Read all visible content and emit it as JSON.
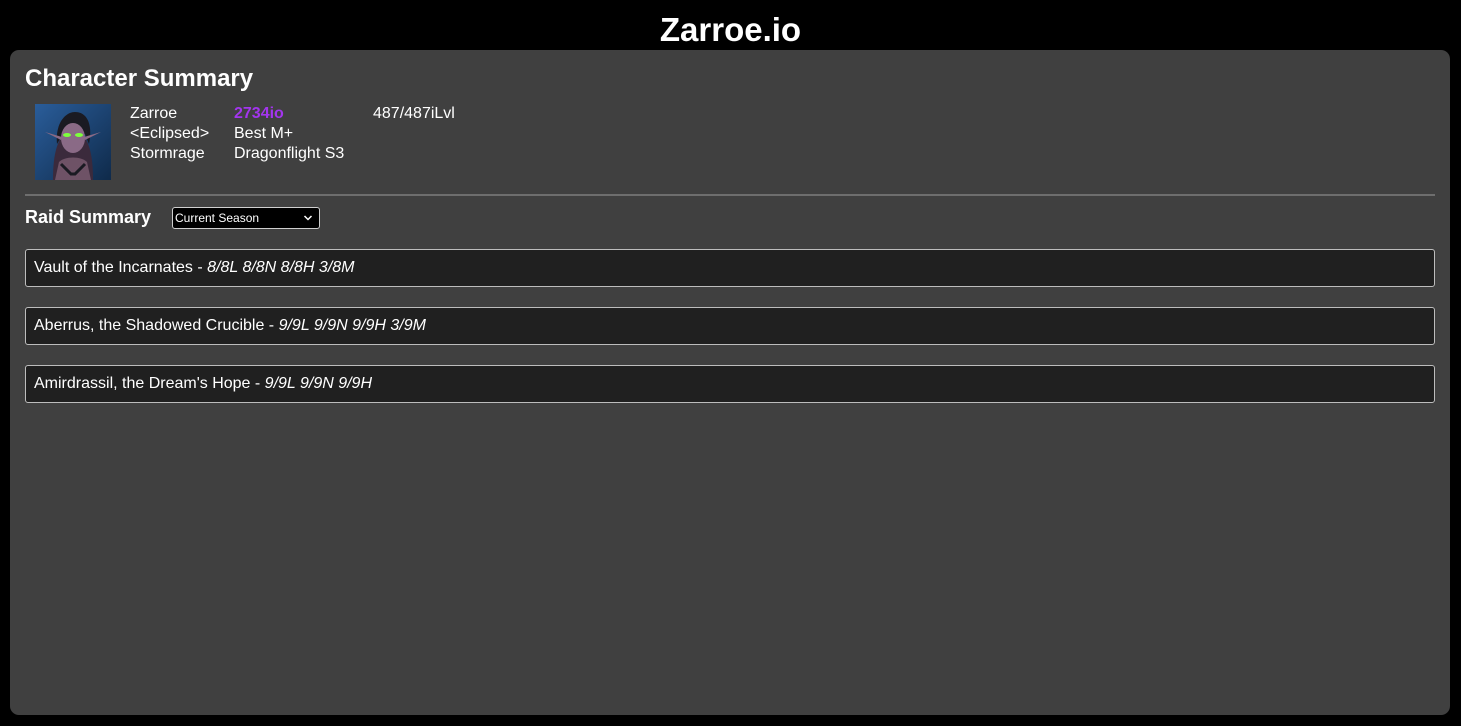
{
  "site": {
    "title": "Zarroe.io"
  },
  "character_summary": {
    "heading": "Character Summary",
    "name": "Zarroe",
    "guild": "<Eclipsed>",
    "realm": "Stormrage",
    "score": "2734io",
    "score_label": "Best M+",
    "season": "Dragonflight S3",
    "item_level": "487/487iLvl",
    "score_color": "#a335ee"
  },
  "raid_summary": {
    "heading": "Raid Summary",
    "season_select": {
      "selected": "Current Season"
    },
    "raids": [
      {
        "name": "Vault of the Incarnates",
        "separator": " - ",
        "progress": "8/8L 8/8N 8/8H 3/8M"
      },
      {
        "name": "Aberrus, the Shadowed Crucible",
        "separator": " - ",
        "progress": "9/9L 9/9N 9/9H 3/9M"
      },
      {
        "name": "Amirdrassil, the Dream's Hope",
        "separator": " - ",
        "progress": "9/9L 9/9N 9/9H"
      }
    ]
  },
  "icons": {
    "select_arrow": "chevron-down-icon"
  }
}
